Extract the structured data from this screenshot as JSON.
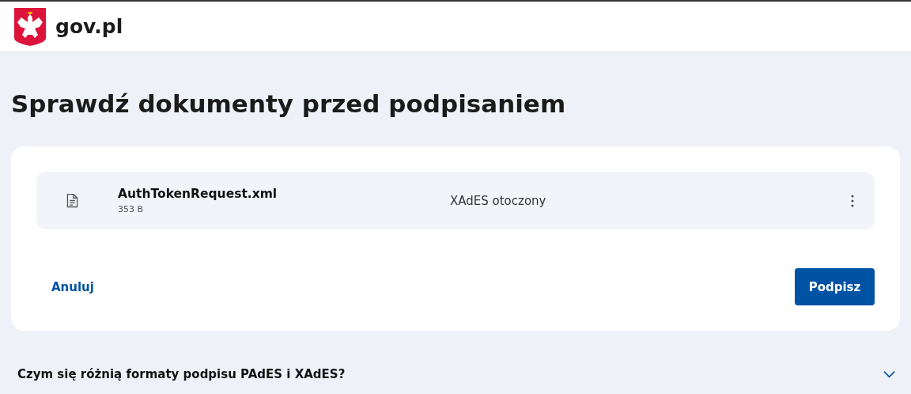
{
  "header": {
    "logo_text": "gov.pl"
  },
  "title": "Sprawdź dokumenty przed podpisaniem",
  "documents": [
    {
      "name": "AuthTokenRequest.xml",
      "size": "353 B",
      "format": "XAdES otoczony"
    }
  ],
  "actions": {
    "cancel": "Anuluj",
    "sign": "Podpisz"
  },
  "faq": [
    {
      "question": "Czym się różnią formaty podpisu PAdES i XAdES?",
      "expanded": false
    }
  ]
}
